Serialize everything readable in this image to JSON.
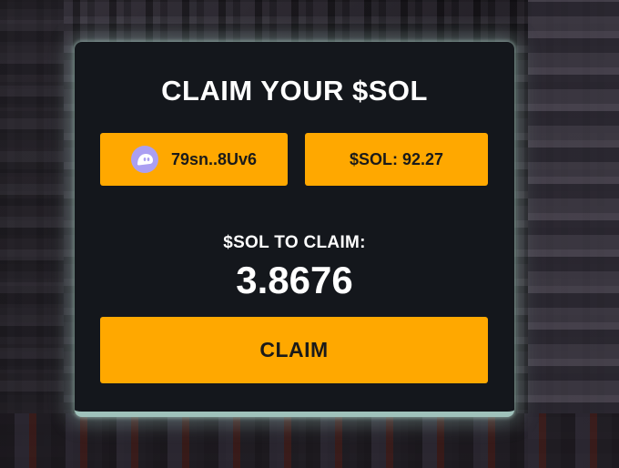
{
  "panel": {
    "title": "CLAIM YOUR $SOL",
    "wallet": {
      "icon": "phantom-ghost-icon",
      "address": "79sn..8Uv6"
    },
    "balance_label": "$SOL: 92.27",
    "claim_label": "$SOL TO CLAIM:",
    "claim_amount": "3.8676",
    "claim_button": "CLAIM"
  },
  "colors": {
    "accent": "#ffa800",
    "panel_bg": "#14171c",
    "panel_glow": "#9fc2bb",
    "wallet_icon": "#ab9ff2"
  }
}
